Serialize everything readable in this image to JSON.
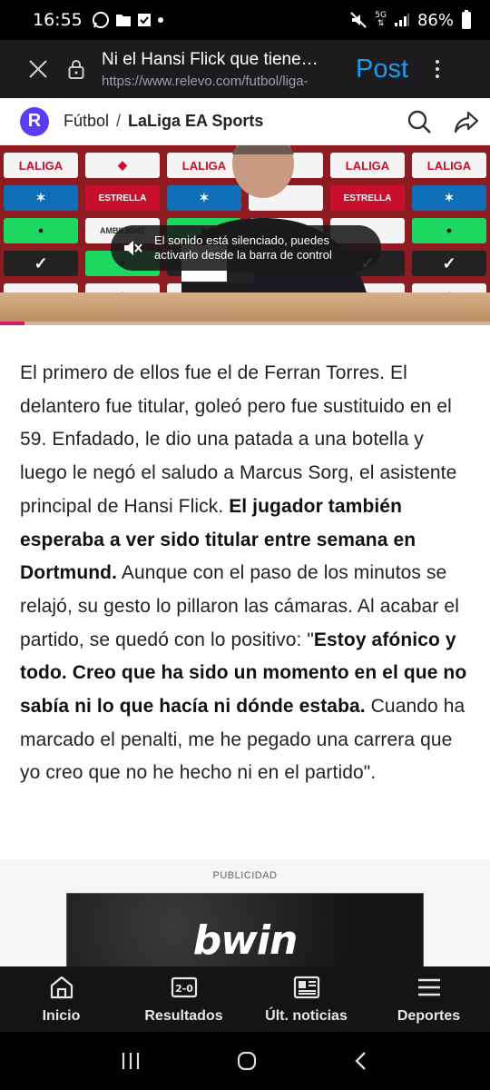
{
  "status_bar": {
    "time": "16:55",
    "battery": "86%",
    "network": "5G",
    "icons": [
      "whatsapp-icon",
      "folder-icon",
      "checkbox-icon",
      "dot-icon",
      "mute-icon",
      "signal-icon",
      "battery-icon"
    ]
  },
  "browser": {
    "page_title": "Ni el Hansi Flick que tiene…",
    "url": "https://www.relevo.com/futbol/liga-",
    "post_label": "Post"
  },
  "site_header": {
    "logo_letter": "R",
    "section": "Fútbol",
    "separator": "/",
    "subsection": "LaLiga EA Sports"
  },
  "video": {
    "toast_line1": "El sonido está silenciado, puedes",
    "toast_line2": "activarlo desde la barra de control",
    "progress_fraction": 0.05
  },
  "article": {
    "p1_a": "El primero de ellos fue el de Ferran Torres. El delantero fue titular, goleó pero fue sustituido en el 59. Enfadado, le dio una patada a una botella y luego le negó el saludo a Marcus Sorg, el asistente principal de Hansi Flick. ",
    "p1_bold": "El jugador también esperaba a ver sido titular entre semana en Dortmund.",
    "p1_b": " Aunque con el paso de los minutos se relajó, su gesto lo pillaron las cámaras. Al acabar el partido, se quedó con lo positivo: \"",
    "p1_bold2": "Estoy afónico y todo. Creo que ha sido un momento en el que no sabía ni lo que hacía ni dónde estaba.",
    "p1_c": " Cuando ha marcado el penalti, me he pegado una carrera que yo creo que no he hecho ni en el partido\"."
  },
  "ad": {
    "label": "PUBLICIDAD",
    "brand": "bwin"
  },
  "bottom_nav": {
    "items": [
      {
        "label": "Inicio",
        "icon": "home-icon"
      },
      {
        "label": "Resultados",
        "icon": "scoreboard-icon"
      },
      {
        "label": "Últ. noticias",
        "icon": "news-icon"
      },
      {
        "label": "Deportes",
        "icon": "menu-icon"
      }
    ]
  },
  "colors": {
    "brand_purple": "#5b3df5",
    "post_blue": "#1d9bf0",
    "progress_pink": "#d81b60"
  }
}
